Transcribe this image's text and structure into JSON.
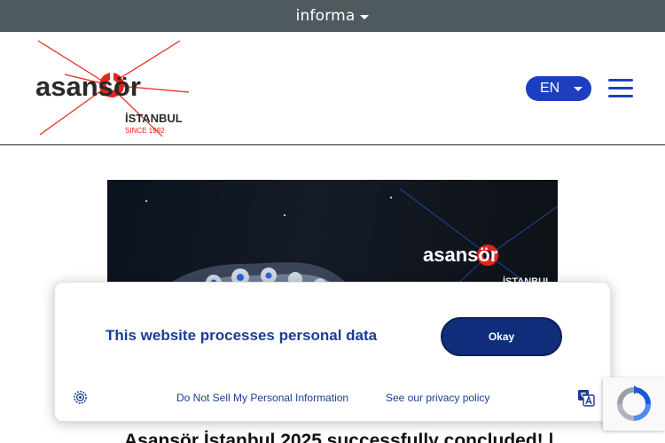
{
  "topbar": {
    "brand": "informa"
  },
  "header": {
    "logo_text": "asansör",
    "logo_city": "İSTANBUL",
    "logo_since": "SINCE 1992",
    "language": "EN"
  },
  "banner": {
    "logo_text": "asansör",
    "logo_city": "İSTANBUL"
  },
  "headline": "Asansör İstanbul 2025 successfully concluded! |",
  "cookie_popup": {
    "message": "This website processes personal data",
    "okay_label": "Okay",
    "do_not_sell": "Do Not Sell My Personal Information",
    "privacy_policy": "See our privacy policy"
  },
  "colors": {
    "accent": "#1d3fbf",
    "popup_text": "#1a3d94",
    "button": "#0f2d7a",
    "logo_red": "#e52421",
    "topbar": "#4f5a5e"
  }
}
